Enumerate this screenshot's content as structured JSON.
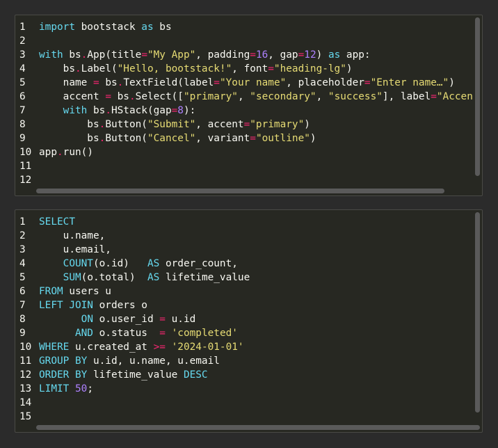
{
  "editors": [
    {
      "id": "python",
      "language": "python",
      "lines": [
        [
          [
            "kw",
            "import"
          ],
          [
            "t",
            " bootstack "
          ],
          [
            "kw",
            "as"
          ],
          [
            "t",
            " bs"
          ]
        ],
        [],
        [
          [
            "kw",
            "with"
          ],
          [
            "t",
            " bs"
          ],
          [
            "op",
            "."
          ],
          [
            "t",
            "App(title"
          ],
          [
            "op",
            "="
          ],
          [
            "str",
            "\"My App\""
          ],
          [
            "t",
            ", padding"
          ],
          [
            "op",
            "="
          ],
          [
            "num",
            "16"
          ],
          [
            "t",
            ", gap"
          ],
          [
            "op",
            "="
          ],
          [
            "num",
            "12"
          ],
          [
            "t",
            ") "
          ],
          [
            "kw",
            "as"
          ],
          [
            "t",
            " app:"
          ]
        ],
        [
          [
            "t",
            "    bs"
          ],
          [
            "op",
            "."
          ],
          [
            "t",
            "Label("
          ],
          [
            "str",
            "\"Hello, bootstack!\""
          ],
          [
            "t",
            ", font"
          ],
          [
            "op",
            "="
          ],
          [
            "str",
            "\"heading-lg\""
          ],
          [
            "t",
            ")"
          ]
        ],
        [
          [
            "t",
            "    name "
          ],
          [
            "op",
            "="
          ],
          [
            "t",
            " bs"
          ],
          [
            "op",
            "."
          ],
          [
            "t",
            "TextField(label"
          ],
          [
            "op",
            "="
          ],
          [
            "str",
            "\"Your name\""
          ],
          [
            "t",
            ", placeholder"
          ],
          [
            "op",
            "="
          ],
          [
            "str",
            "\"Enter name…\""
          ],
          [
            "t",
            ")"
          ]
        ],
        [
          [
            "t",
            "    accent "
          ],
          [
            "op",
            "="
          ],
          [
            "t",
            " bs"
          ],
          [
            "op",
            "."
          ],
          [
            "t",
            "Select(["
          ],
          [
            "str",
            "\"primary\""
          ],
          [
            "t",
            ", "
          ],
          [
            "str",
            "\"secondary\""
          ],
          [
            "t",
            ", "
          ],
          [
            "str",
            "\"success\""
          ],
          [
            "t",
            "], label"
          ],
          [
            "op",
            "="
          ],
          [
            "str",
            "\"Accent\""
          ],
          [
            "t",
            ")"
          ]
        ],
        [
          [
            "t",
            "    "
          ],
          [
            "kw",
            "with"
          ],
          [
            "t",
            " bs"
          ],
          [
            "op",
            "."
          ],
          [
            "t",
            "HStack(gap"
          ],
          [
            "op",
            "="
          ],
          [
            "num",
            "8"
          ],
          [
            "t",
            "):"
          ]
        ],
        [
          [
            "t",
            "        bs"
          ],
          [
            "op",
            "."
          ],
          [
            "t",
            "Button("
          ],
          [
            "str",
            "\"Submit\""
          ],
          [
            "t",
            ", accent"
          ],
          [
            "op",
            "="
          ],
          [
            "str",
            "\"primary\""
          ],
          [
            "t",
            ")"
          ]
        ],
        [
          [
            "t",
            "        bs"
          ],
          [
            "op",
            "."
          ],
          [
            "t",
            "Button("
          ],
          [
            "str",
            "\"Cancel\""
          ],
          [
            "t",
            ", variant"
          ],
          [
            "op",
            "="
          ],
          [
            "str",
            "\"outline\""
          ],
          [
            "t",
            ")"
          ]
        ],
        [
          [
            "t",
            "app"
          ],
          [
            "op",
            "."
          ],
          [
            "t",
            "run()"
          ]
        ],
        [],
        []
      ]
    },
    {
      "id": "sql",
      "language": "sql",
      "lines": [
        [
          [
            "kw",
            "SELECT"
          ]
        ],
        [
          [
            "t",
            "    u.name,"
          ]
        ],
        [
          [
            "t",
            "    u.email,"
          ]
        ],
        [
          [
            "t",
            "    "
          ],
          [
            "kw",
            "COUNT"
          ],
          [
            "t",
            "(o.id)   "
          ],
          [
            "kw",
            "AS"
          ],
          [
            "t",
            " order_count,"
          ]
        ],
        [
          [
            "t",
            "    "
          ],
          [
            "kw",
            "SUM"
          ],
          [
            "t",
            "(o.total)  "
          ],
          [
            "kw",
            "AS"
          ],
          [
            "t",
            " lifetime_value"
          ]
        ],
        [
          [
            "kw",
            "FROM"
          ],
          [
            "t",
            " users u"
          ]
        ],
        [
          [
            "kw",
            "LEFT JOIN"
          ],
          [
            "t",
            " orders o"
          ]
        ],
        [
          [
            "t",
            "       "
          ],
          [
            "kw",
            "ON"
          ],
          [
            "t",
            " o.user_id "
          ],
          [
            "op",
            "="
          ],
          [
            "t",
            " u.id"
          ]
        ],
        [
          [
            "t",
            "      "
          ],
          [
            "kw",
            "AND"
          ],
          [
            "t",
            " o.status  "
          ],
          [
            "op",
            "="
          ],
          [
            "t",
            " "
          ],
          [
            "str",
            "'completed'"
          ]
        ],
        [
          [
            "kw",
            "WHERE"
          ],
          [
            "t",
            " u.created_at "
          ],
          [
            "op",
            ">="
          ],
          [
            "t",
            " "
          ],
          [
            "str",
            "'2024-01-01'"
          ]
        ],
        [
          [
            "kw",
            "GROUP BY"
          ],
          [
            "t",
            " u.id, u.name, u.email"
          ]
        ],
        [
          [
            "kw",
            "ORDER BY"
          ],
          [
            "t",
            " lifetime_value "
          ],
          [
            "kw",
            "DESC"
          ]
        ],
        [
          [
            "kw",
            "LIMIT"
          ],
          [
            "t",
            " "
          ],
          [
            "num",
            "50"
          ],
          [
            "t",
            ";"
          ]
        ],
        [],
        []
      ]
    }
  ],
  "theme": {
    "background": "#272822",
    "text": "#f8f8f2",
    "keyword": "#66d9ef",
    "operator": "#f92672",
    "string": "#e6db74",
    "number": "#ae81ff"
  }
}
